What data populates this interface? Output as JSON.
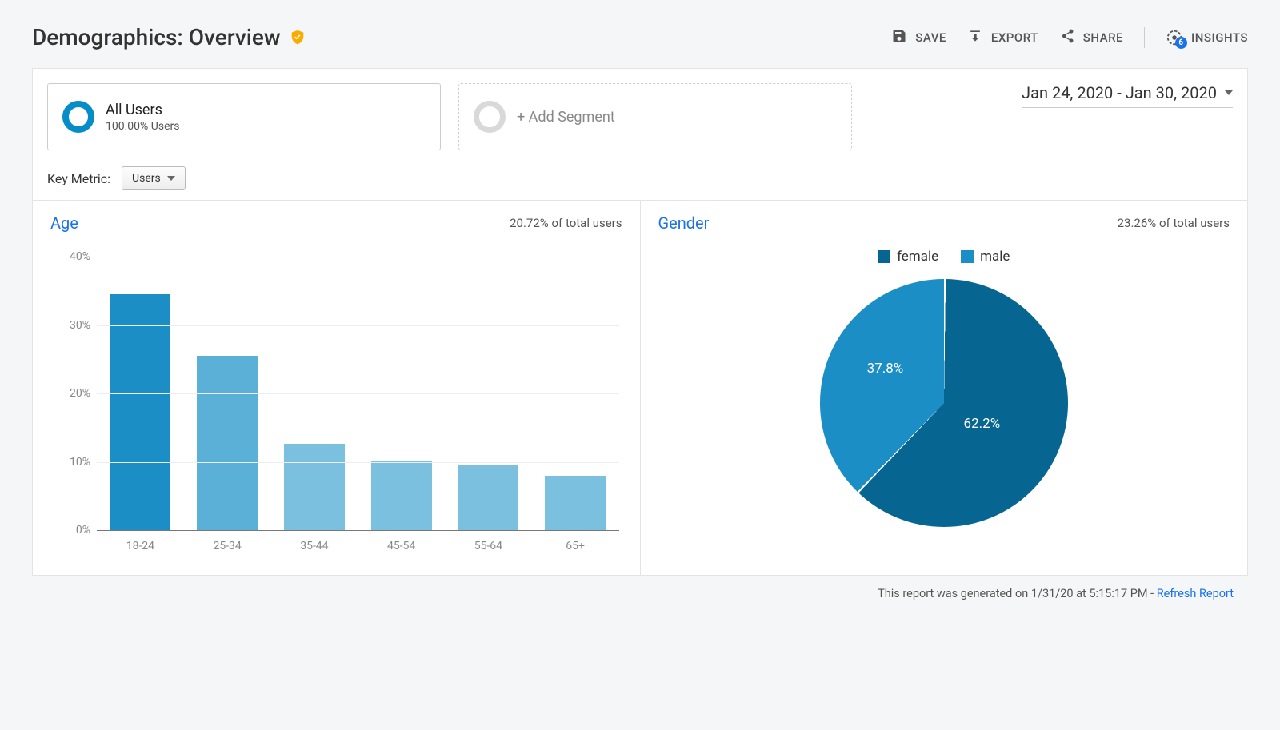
{
  "header": {
    "title": "Demographics: Overview",
    "actions": {
      "save": "SAVE",
      "export": "EXPORT",
      "share": "SHARE",
      "insights": "INSIGHTS",
      "insights_badge": "6"
    }
  },
  "segments": {
    "all_users": {
      "title": "All Users",
      "sub": "100.00% Users"
    },
    "add": "+ Add Segment",
    "date_range": "Jan 24, 2020 - Jan 30, 2020"
  },
  "key_metric": {
    "label": "Key Metric:",
    "value": "Users"
  },
  "age_card": {
    "title": "Age",
    "subtitle": "20.72% of total users"
  },
  "gender_card": {
    "title": "Gender",
    "subtitle": "23.26% of total users",
    "legend_female": "female",
    "legend_male": "male",
    "female_pct": "62.2%",
    "male_pct": "37.8%"
  },
  "footer": {
    "text": "This report was generated on 1/31/20 at 5:15:17 PM - ",
    "link": "Refresh Report"
  },
  "chart_data": [
    {
      "type": "bar",
      "title": "Age",
      "categories": [
        "18-24",
        "25-34",
        "35-44",
        "45-54",
        "55-64",
        "65+"
      ],
      "values": [
        34.5,
        25.5,
        12.6,
        10.1,
        9.6,
        8.0
      ],
      "ylabel": "%",
      "ylim": [
        0,
        40
      ],
      "yticks": [
        0,
        10,
        20,
        30,
        40
      ]
    },
    {
      "type": "pie",
      "title": "Gender",
      "series": [
        {
          "name": "female",
          "value": 62.2,
          "color": "#066591"
        },
        {
          "name": "male",
          "value": 37.8,
          "color": "#1b8ec6"
        }
      ]
    }
  ]
}
